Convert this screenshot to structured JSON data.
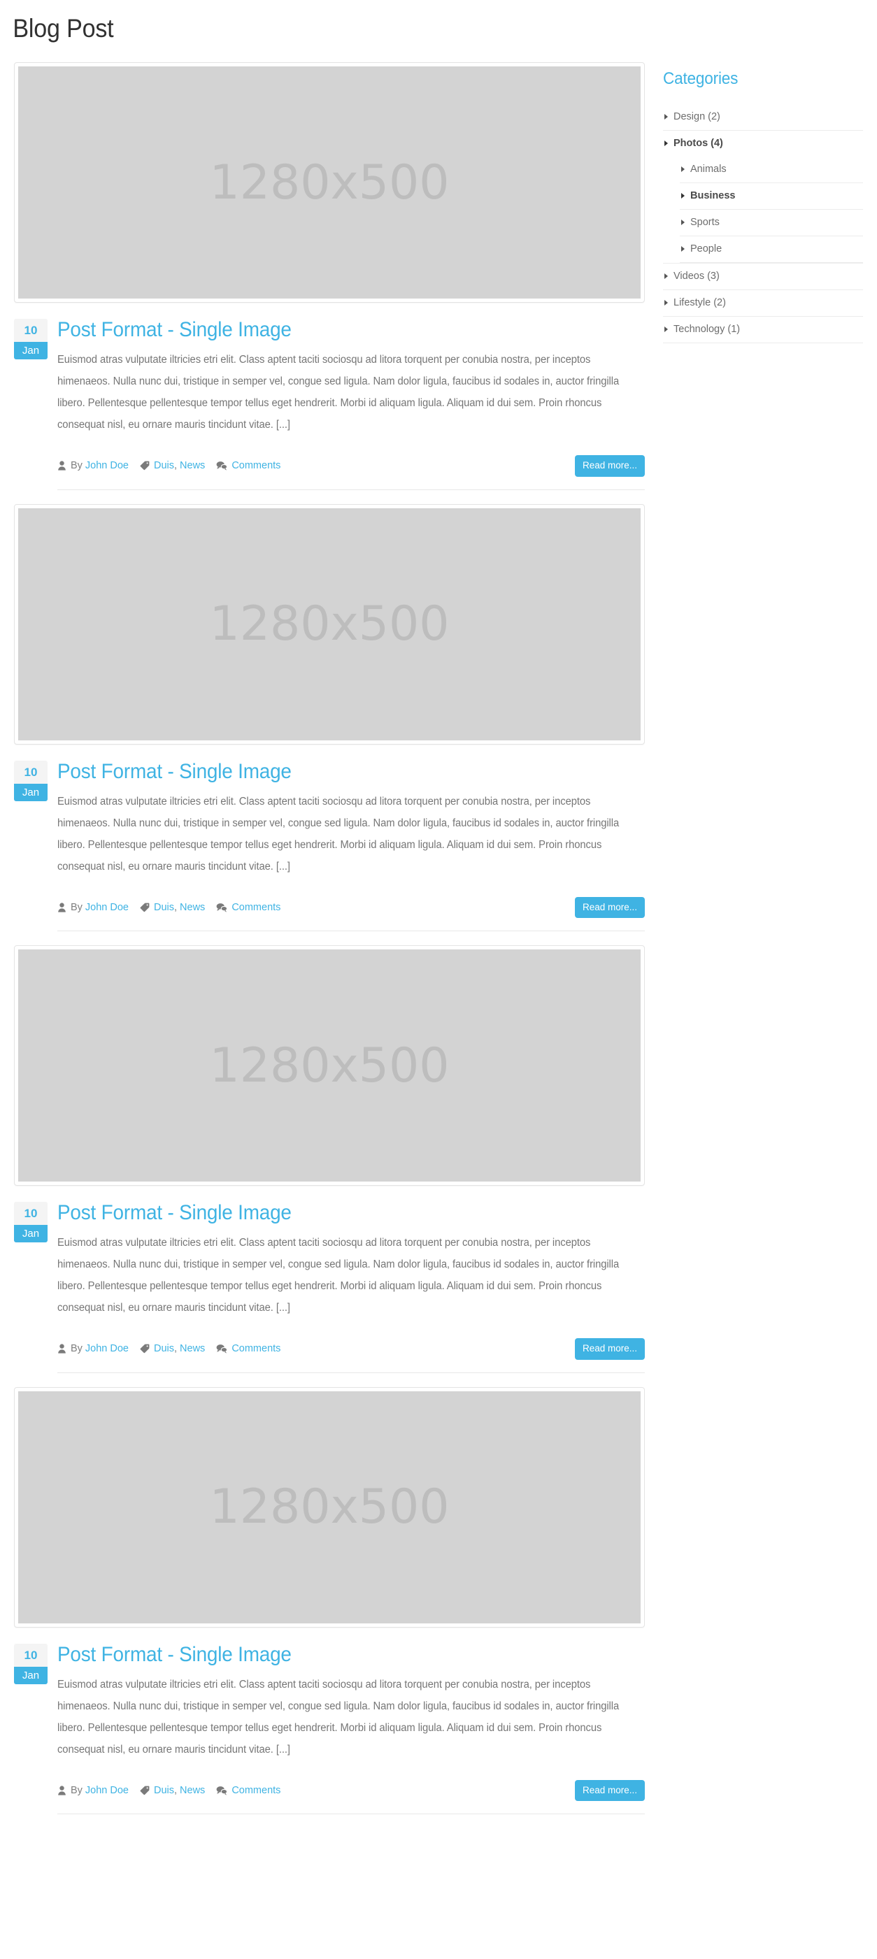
{
  "page": {
    "title": "Blog Post",
    "placeholder_label": "1280x500"
  },
  "colors": {
    "accent": "#3fb3e3",
    "title_text": "#313131",
    "body_text": "#767676",
    "placeholder_bg": "#d3d3d3",
    "placeholder_text": "#bdbdbd",
    "badge_day_bg": "#f4f4f4",
    "divider": "#e8e8e8"
  },
  "posts": [
    {
      "date": {
        "day": "10",
        "month": "Jan"
      },
      "image_label": "1280x500",
      "title": "Post Format - Single Image",
      "excerpt": "Euismod atras vulputate iltricies etri elit. Class aptent taciti sociosqu ad litora torquent per conubia nostra, per inceptos himenaeos. Nulla nunc dui, tristique in semper vel, congue sed ligula. Nam dolor ligula, faucibus id sodales in, auctor fringilla libero. Pellentesque pellentesque tempor tellus eget hendrerit. Morbi id aliquam ligula. Aliquam id dui sem. Proin rhoncus consequat nisl, eu ornare mauris tincidunt vitae. [...]",
      "meta": {
        "by_label": "By",
        "author": "John Doe",
        "tag_first": "Duis",
        "tag_separator": ",",
        "tag_second": "News",
        "comments": "Comments"
      },
      "read_more": "Read more..."
    },
    {
      "date": {
        "day": "10",
        "month": "Jan"
      },
      "image_label": "1280x500",
      "title": "Post Format - Single Image",
      "excerpt": "Euismod atras vulputate iltricies etri elit. Class aptent taciti sociosqu ad litora torquent per conubia nostra, per inceptos himenaeos. Nulla nunc dui, tristique in semper vel, congue sed ligula. Nam dolor ligula, faucibus id sodales in, auctor fringilla libero. Pellentesque pellentesque tempor tellus eget hendrerit. Morbi id aliquam ligula. Aliquam id dui sem. Proin rhoncus consequat nisl, eu ornare mauris tincidunt vitae. [...]",
      "meta": {
        "by_label": "By",
        "author": "John Doe",
        "tag_first": "Duis",
        "tag_separator": ",",
        "tag_second": "News",
        "comments": "Comments"
      },
      "read_more": "Read more..."
    },
    {
      "date": {
        "day": "10",
        "month": "Jan"
      },
      "image_label": "1280x500",
      "title": "Post Format - Single Image",
      "excerpt": "Euismod atras vulputate iltricies etri elit. Class aptent taciti sociosqu ad litora torquent per conubia nostra, per inceptos himenaeos. Nulla nunc dui, tristique in semper vel, congue sed ligula. Nam dolor ligula, faucibus id sodales in, auctor fringilla libero. Pellentesque pellentesque tempor tellus eget hendrerit. Morbi id aliquam ligula. Aliquam id dui sem. Proin rhoncus consequat nisl, eu ornare mauris tincidunt vitae. [...]",
      "meta": {
        "by_label": "By",
        "author": "John Doe",
        "tag_first": "Duis",
        "tag_separator": ",",
        "tag_second": "News",
        "comments": "Comments"
      },
      "read_more": "Read more..."
    },
    {
      "date": {
        "day": "10",
        "month": "Jan"
      },
      "image_label": "1280x500",
      "title": "Post Format - Single Image",
      "excerpt": "Euismod atras vulputate iltricies etri elit. Class aptent taciti sociosqu ad litora torquent per conubia nostra, per inceptos himenaeos. Nulla nunc dui, tristique in semper vel, congue sed ligula. Nam dolor ligula, faucibus id sodales in, auctor fringilla libero. Pellentesque pellentesque tempor tellus eget hendrerit. Morbi id aliquam ligula. Aliquam id dui sem. Proin rhoncus consequat nisl, eu ornare mauris tincidunt vitae. [...]",
      "meta": {
        "by_label": "By",
        "author": "John Doe",
        "tag_first": "Duis",
        "tag_separator": ",",
        "tag_second": "News",
        "comments": "Comments"
      },
      "read_more": "Read more..."
    }
  ],
  "sidebar": {
    "widget_title": "Categories",
    "categories": [
      {
        "label": "Design (2)",
        "active": false,
        "children": []
      },
      {
        "label": "Photos (4)",
        "active": true,
        "children": [
          {
            "label": "Animals",
            "active": false
          },
          {
            "label": "Business",
            "active": true
          },
          {
            "label": "Sports",
            "active": false
          },
          {
            "label": "People",
            "active": false
          }
        ]
      },
      {
        "label": "Videos (3)",
        "active": false,
        "children": []
      },
      {
        "label": "Lifestyle (2)",
        "active": false,
        "children": []
      },
      {
        "label": "Technology (1)",
        "active": false,
        "children": []
      }
    ]
  },
  "icons": {
    "author": "user-icon",
    "tags": "tag-icon",
    "comments": "comment-icon",
    "caret": "caret-right-icon"
  }
}
